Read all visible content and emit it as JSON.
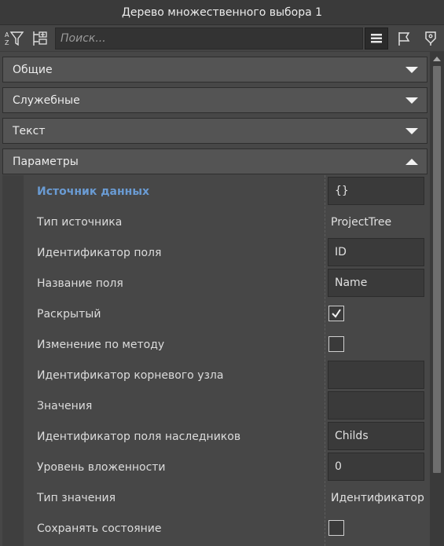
{
  "window": {
    "title": "Дерево множественного выбора 1"
  },
  "toolbar": {
    "sort_icon": "sort-az-icon",
    "filter_icon": "filter-icon",
    "expand_icon": "expand-tree-icon",
    "search_placeholder": "Поиск...",
    "view_list_icon": "list-view-icon",
    "flag_icon": "flag-icon",
    "tag_icon": "tag-icon"
  },
  "sections": [
    {
      "label": "Общие",
      "expanded": false
    },
    {
      "label": "Служебные",
      "expanded": false
    },
    {
      "label": "Текст",
      "expanded": false
    },
    {
      "label": "Параметры",
      "expanded": true
    }
  ],
  "properties": [
    {
      "label": "Источник данных",
      "type": "input",
      "value": "{}",
      "active": true
    },
    {
      "label": "Тип источника",
      "type": "text",
      "value": "ProjectTree"
    },
    {
      "label": "Идентификатор поля",
      "type": "input",
      "value": "ID"
    },
    {
      "label": "Название поля",
      "type": "input",
      "value": "Name"
    },
    {
      "label": "Раскрытый",
      "type": "checkbox",
      "checked": true
    },
    {
      "label": "Изменение по методу",
      "type": "checkbox",
      "checked": false
    },
    {
      "label": "Идентификатор корневого узла",
      "type": "input",
      "value": ""
    },
    {
      "label": "Значения",
      "type": "input",
      "value": ""
    },
    {
      "label": "Идентификатор поля наследников",
      "type": "input",
      "value": "Childs"
    },
    {
      "label": "Уровень вложенности",
      "type": "input",
      "value": "0"
    },
    {
      "label": "Тип значения",
      "type": "text",
      "value": "Идентификатор"
    },
    {
      "label": "Сохранять состояние",
      "type": "checkbox",
      "checked": false
    }
  ],
  "colors": {
    "accent": "#6a9bd3",
    "panel": "#474747",
    "section": "#545454"
  }
}
